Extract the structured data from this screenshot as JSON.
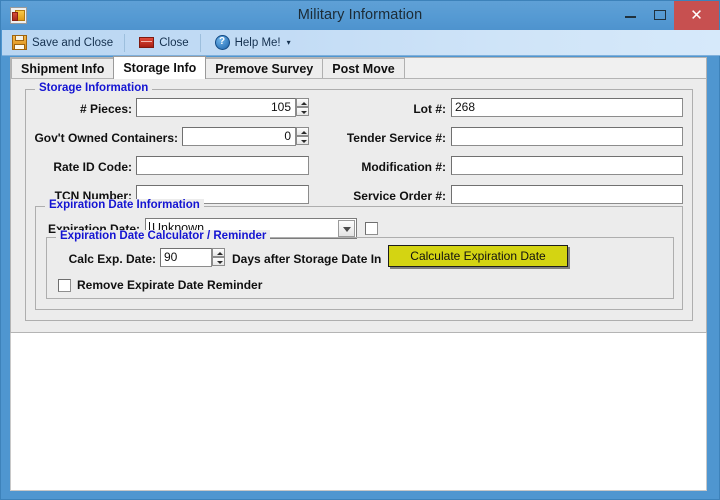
{
  "window": {
    "title": "Military Information",
    "app_icon": "access-form-icon",
    "minimize_label": "–",
    "maximize_label": "□",
    "close_label": "✕",
    "close_button_color": "#c75050",
    "titlebar_color": "#559ad3"
  },
  "toolbar": {
    "save_and_close_label": "Save and Close",
    "close_label": "Close",
    "help_label": "Help Me!",
    "help_caret": "▾"
  },
  "tabs": [
    {
      "label": "Shipment Info",
      "active": false
    },
    {
      "label": "Storage Info",
      "active": true
    },
    {
      "label": "Premove Survey",
      "active": false
    },
    {
      "label": "Post Move",
      "active": false
    }
  ],
  "storage_information": {
    "group_title": "Storage Information",
    "fields": {
      "pieces": {
        "label": "# Pieces:",
        "value": "105",
        "spinner": true
      },
      "govt_owned_containers": {
        "label": "Gov't Owned Containers:",
        "value": "0",
        "spinner": true
      },
      "rate_id_code": {
        "label": "Rate ID Code:",
        "value": ""
      },
      "tcn_number": {
        "label": "TCN Number:",
        "value": ""
      },
      "lot_number": {
        "label": "Lot #:",
        "value": "268"
      },
      "tender_service_number": {
        "label": "Tender Service #:",
        "value": ""
      },
      "modification_number": {
        "label": "Modification #:",
        "value": ""
      },
      "service_order_number": {
        "label": "Service Order #:",
        "value": ""
      }
    }
  },
  "expiration_date_information": {
    "group_title": "Expiration Date Information",
    "expiration_date": {
      "label": "Expiration Date:",
      "value": "Unknown",
      "checkbox_checked": false
    },
    "calculator": {
      "group_title": "Expiration Date Calculator / Reminder",
      "calc_exp_date_label": "Calc Exp. Date:",
      "days_value": "90",
      "days_after_label": "Days after Storage Date In",
      "calculate_button_label": "Calculate Expiration Date",
      "calculate_button_color": "#d4d412",
      "remove_reminder_label": "Remove Expirate Date Reminder",
      "remove_reminder_checked": false
    }
  },
  "theme": {
    "group_title_color": "#1414d2",
    "panel_bg": "#ececec"
  }
}
